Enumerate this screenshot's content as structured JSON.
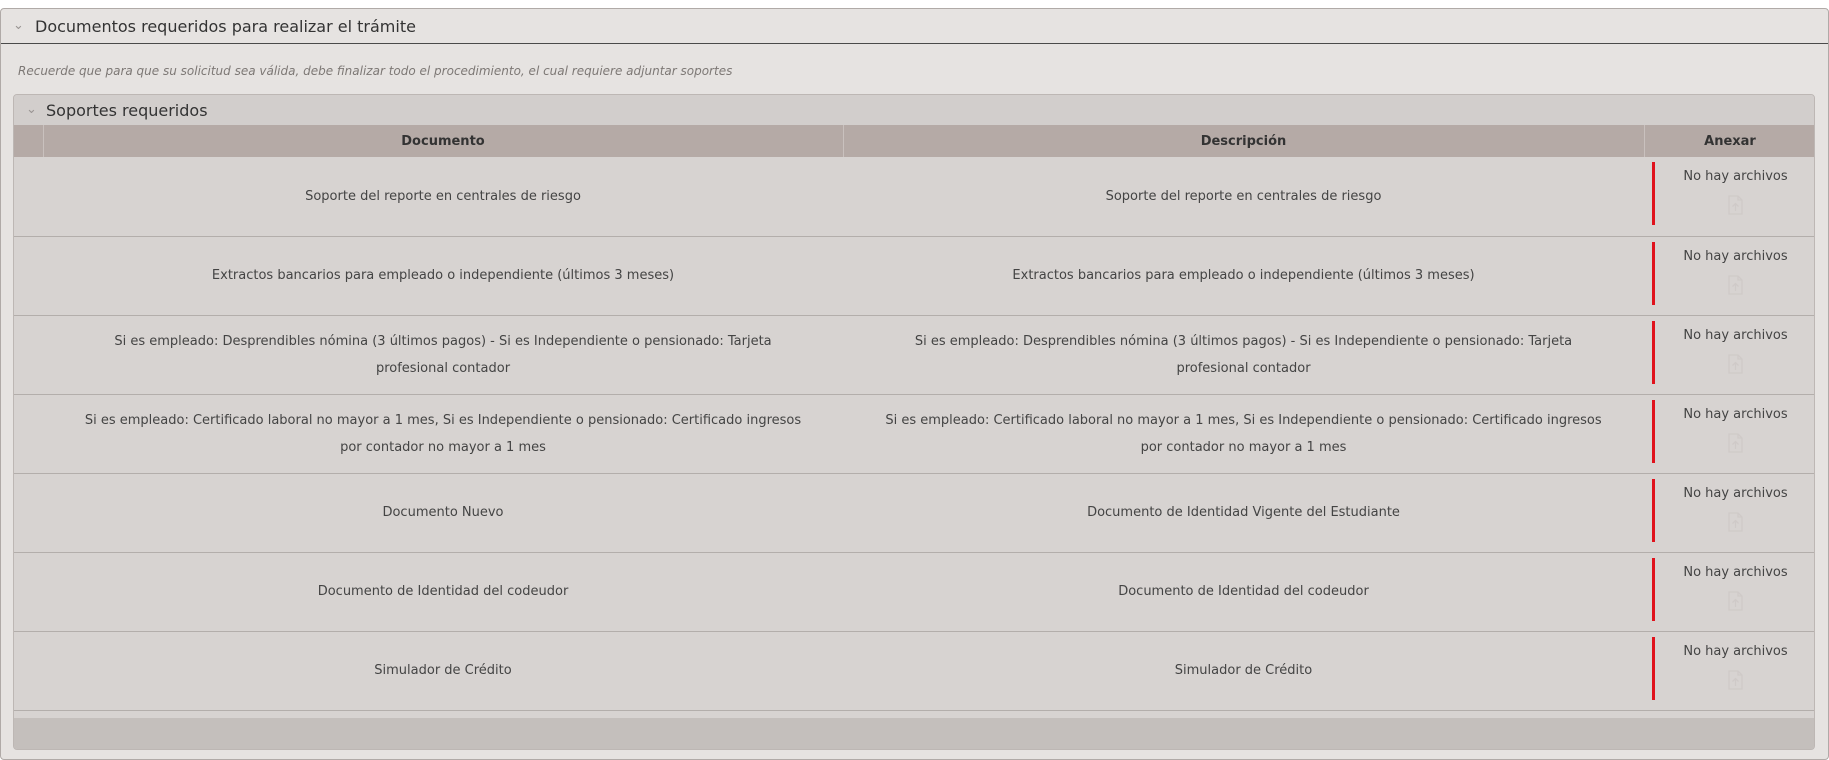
{
  "outer_panel": {
    "title": "Documentos requeridos para realizar el trámite",
    "notice": "Recuerde que para que su solicitud sea válida, debe finalizar todo el procedimiento, el cual requiere adjuntar soportes"
  },
  "inner_panel": {
    "title": "Soportes requeridos",
    "columns": {
      "documento": "Documento",
      "descripcion": "Descripción",
      "anexar": "Anexar"
    },
    "rows": [
      {
        "documento": "Soporte del reporte en centrales de riesgo",
        "descripcion": "Soporte del reporte en centrales de riesgo",
        "anexar": "No hay archivos"
      },
      {
        "documento": "Extractos bancarios para empleado o independiente (últimos 3 meses)",
        "descripcion": "Extractos bancarios para empleado o independiente (últimos 3 meses)",
        "anexar": "No hay archivos"
      },
      {
        "documento": "Si es empleado: Desprendibles nómina (3 últimos pagos) - Si es Independiente o pensionado: Tarjeta profesional contador",
        "descripcion": "Si es empleado: Desprendibles nómina (3 últimos pagos) - Si es Independiente o pensionado: Tarjeta profesional contador",
        "anexar": "No hay archivos"
      },
      {
        "documento": "Si es empleado: Certificado laboral no mayor a 1 mes, Si es Independiente o pensionado: Certificado ingresos por contador no mayor a 1 mes",
        "descripcion": "Si es empleado: Certificado laboral no mayor a 1 mes, Si es Independiente o pensionado: Certificado ingresos por contador no mayor a 1 mes",
        "anexar": "No hay archivos"
      },
      {
        "documento": "Documento Nuevo",
        "descripcion": "Documento de Identidad Vigente del Estudiante",
        "anexar": "No hay archivos"
      },
      {
        "documento": "Documento de Identidad del codeudor",
        "descripcion": "Documento de Identidad del codeudor",
        "anexar": "No hay archivos"
      },
      {
        "documento": "Simulador de Crédito",
        "descripcion": "Simulador de Crédito",
        "anexar": "No hay archivos"
      }
    ]
  },
  "icons": {
    "collapse": "chevron-down-icon",
    "upload": "upload-file-icon"
  },
  "colors": {
    "required_marker": "#e0121c",
    "header_bg": "#b5aaa6",
    "panel_bg": "#e6e3e1"
  }
}
